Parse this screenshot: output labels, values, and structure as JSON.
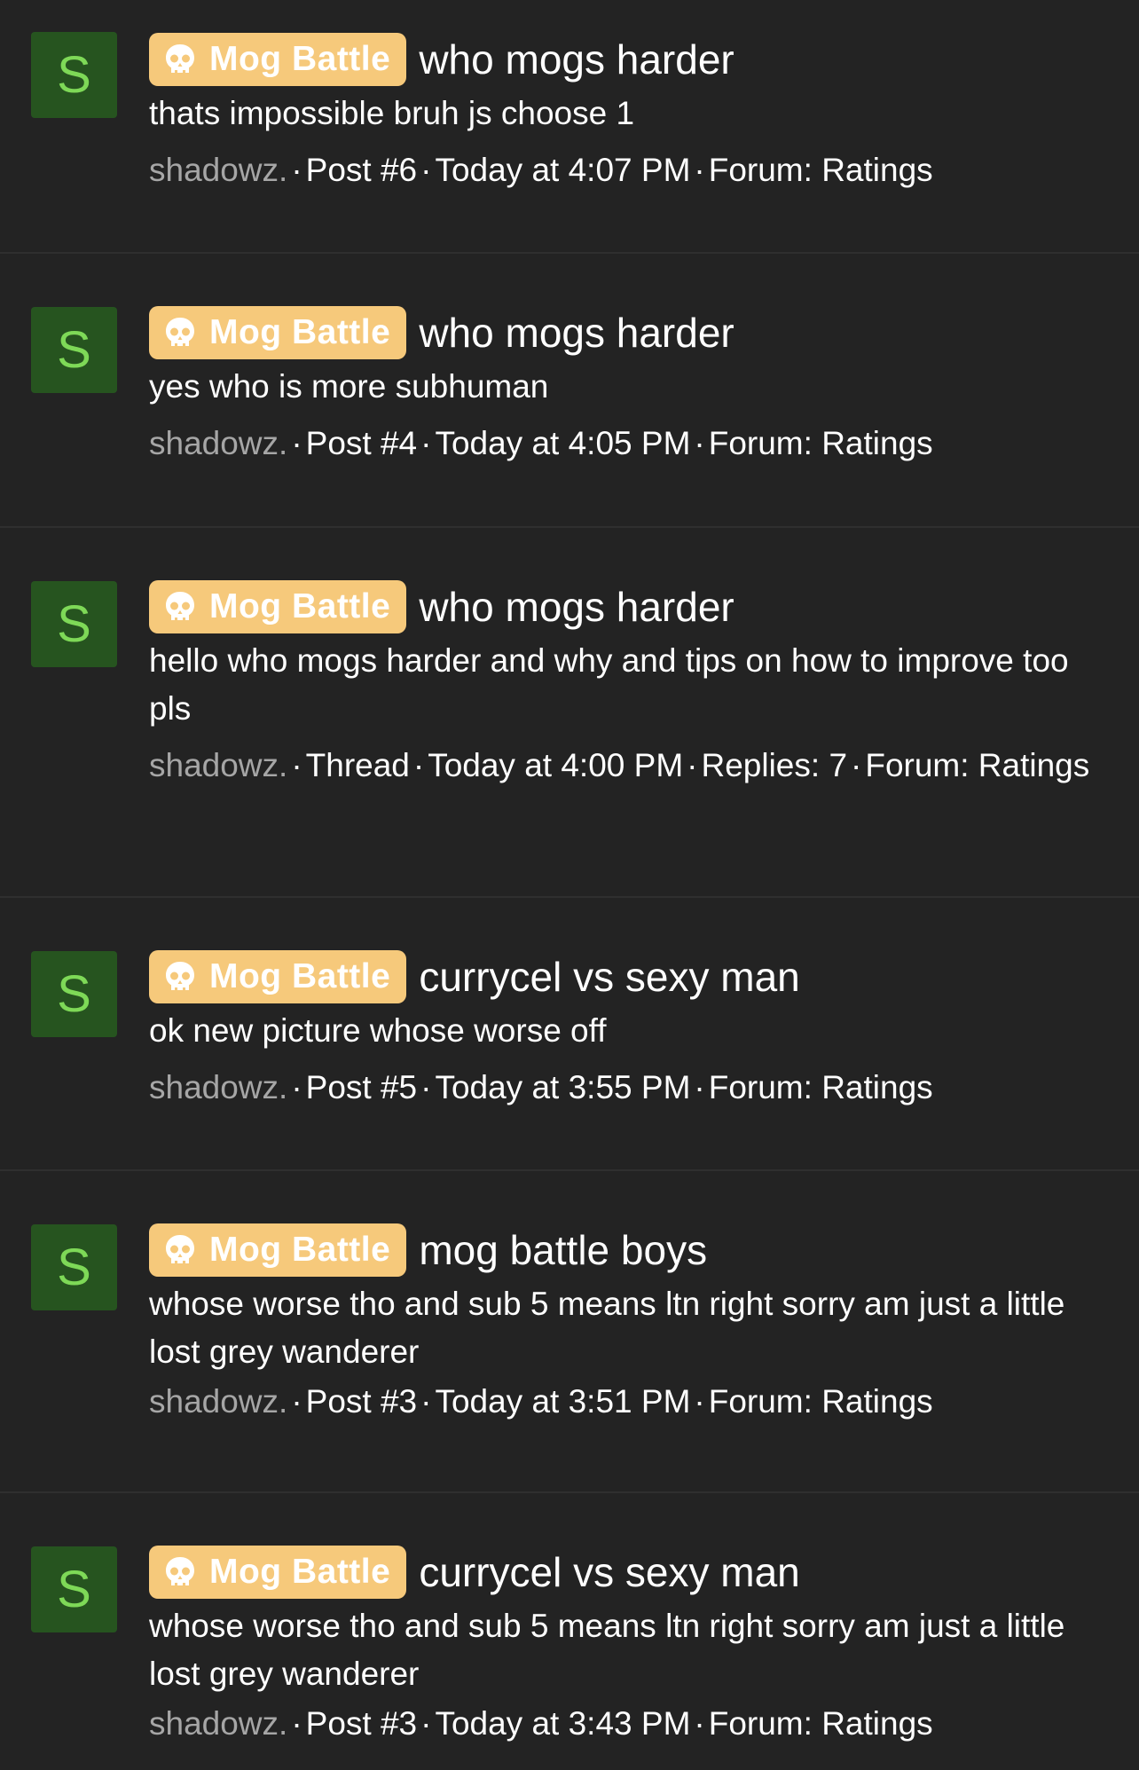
{
  "prefix_label": "Mog Battle",
  "results": [
    {
      "avatar_letter": "S",
      "title": "who mogs harder",
      "snippet": "thats impossible bruh js choose 1",
      "user": "shadowz.",
      "meta": [
        "Post #6",
        "Today at 4:07 PM",
        "Forum: Ratings"
      ]
    },
    {
      "avatar_letter": "S",
      "title": "who mogs harder",
      "snippet": "yes who is more subhuman",
      "user": "shadowz.",
      "meta": [
        "Post #4",
        "Today at 4:05 PM",
        "Forum: Ratings"
      ]
    },
    {
      "avatar_letter": "S",
      "title": "who mogs harder",
      "snippet": "hello who mogs harder and why and tips on how to improve too pls",
      "user": "shadowz.",
      "meta": [
        "Thread",
        "Today at 4:00 PM",
        "Replies: 7",
        "Forum: Ratings"
      ]
    },
    {
      "avatar_letter": "S",
      "title": "currycel vs sexy man",
      "snippet": "ok new picture whose worse off",
      "user": "shadowz.",
      "meta": [
        "Post #5",
        "Today at 3:55 PM",
        "Forum: Ratings"
      ]
    },
    {
      "avatar_letter": "S",
      "title": "mog battle boys",
      "snippet": "whose worse tho and sub 5 means ltn right sorry am just a little lost grey wanderer",
      "user": "shadowz.",
      "meta": [
        "Post #3",
        "Today at 3:51 PM",
        "Forum: Ratings"
      ]
    },
    {
      "avatar_letter": "S",
      "title": "currycel vs sexy man",
      "snippet": "whose worse tho and sub 5 means ltn right sorry am just a little lost grey wanderer",
      "user": "shadowz.",
      "meta": [
        "Post #3",
        "Today at 3:43 PM",
        "Forum: Ratings"
      ]
    }
  ]
}
